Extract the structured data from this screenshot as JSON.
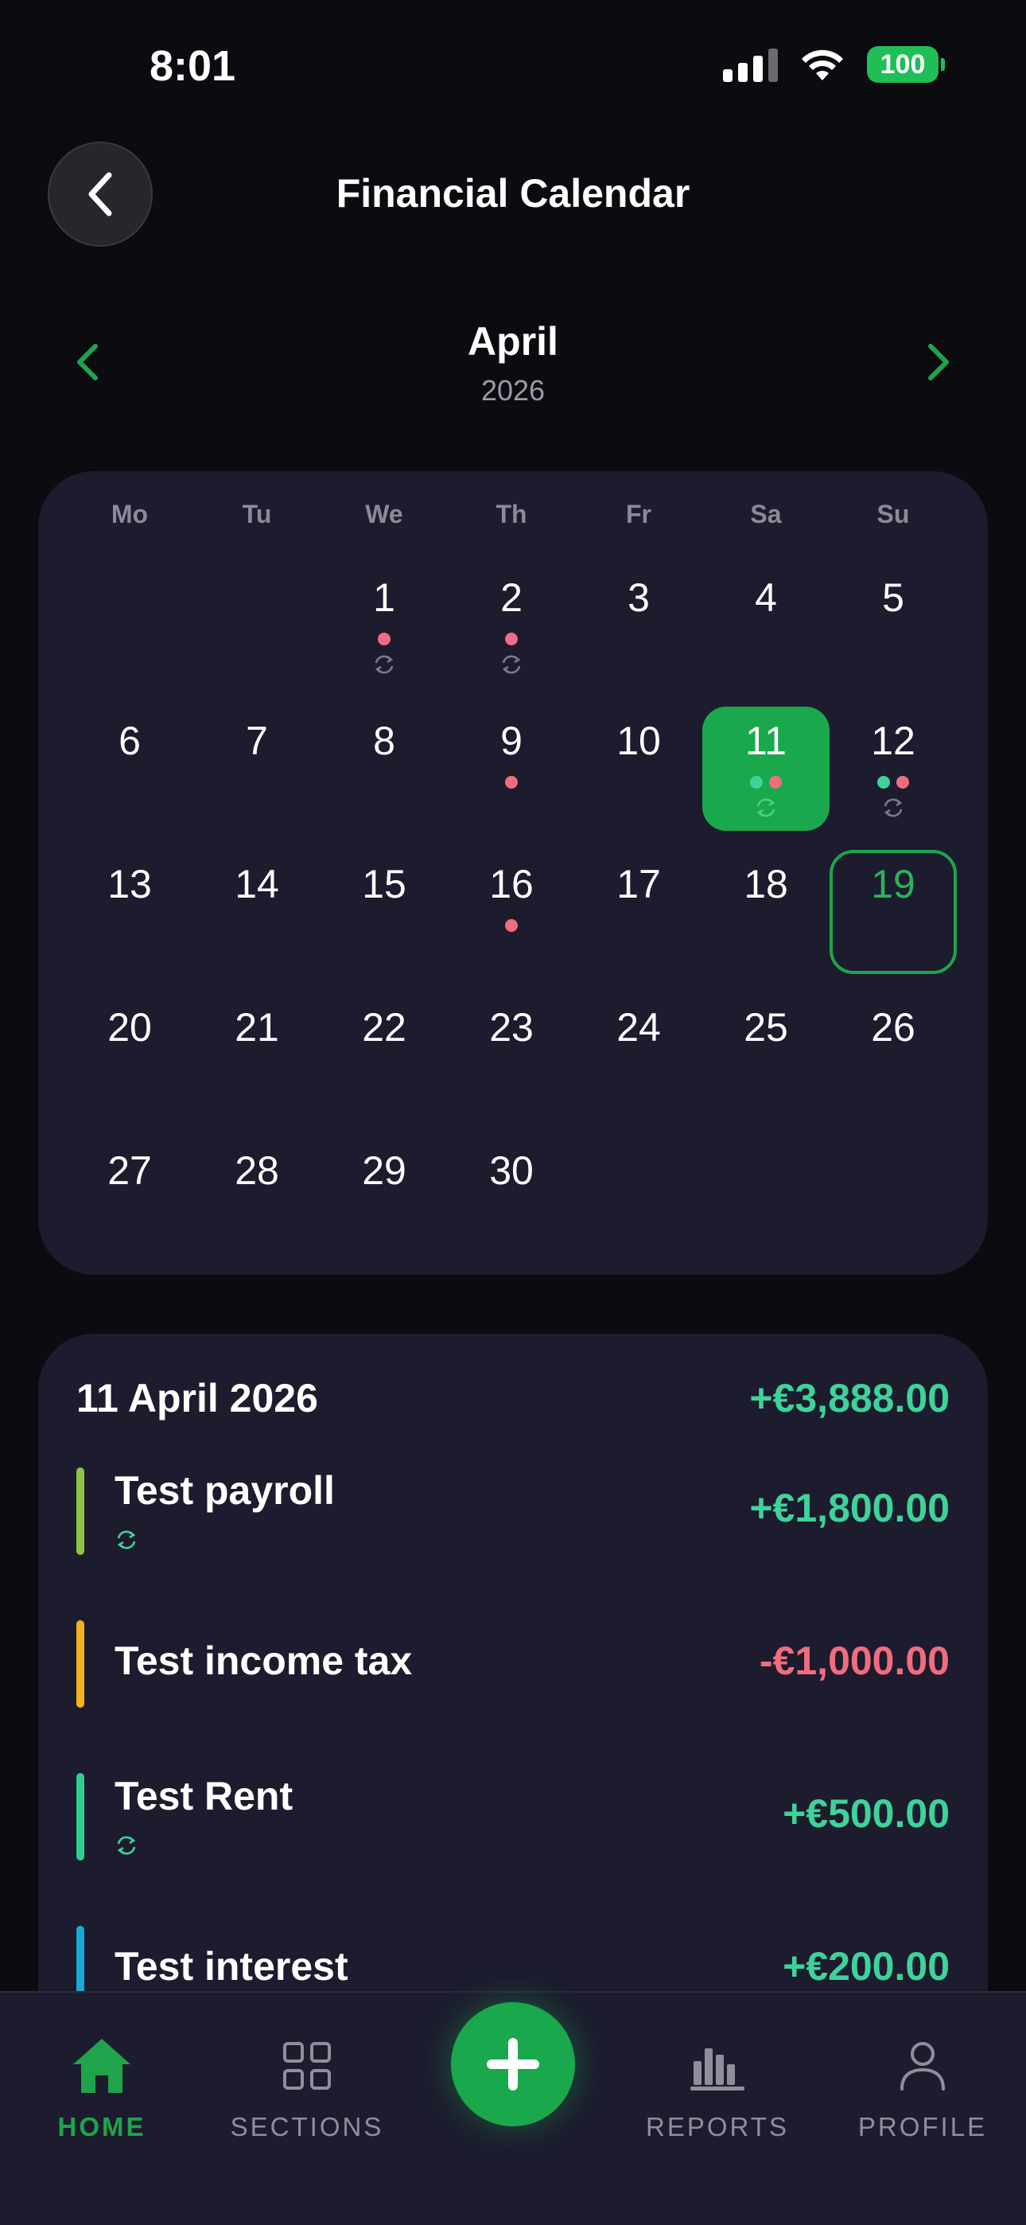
{
  "status_bar": {
    "time": "8:01",
    "battery": "100",
    "icons": [
      "signal-icon",
      "wifi-icon",
      "battery-icon"
    ]
  },
  "header": {
    "title": "Financial Calendar",
    "back_icon": "chevron-left-icon"
  },
  "month_nav": {
    "month": "April",
    "year": "2026",
    "prev_icon": "chevron-left-icon",
    "next_icon": "chevron-right-icon"
  },
  "calendar": {
    "weekdays": [
      "Mo",
      "Tu",
      "We",
      "Th",
      "Fr",
      "Sa",
      "Su"
    ],
    "weeks": [
      [
        "",
        "",
        "1",
        "2",
        "3",
        "4",
        "5"
      ],
      [
        "6",
        "7",
        "8",
        "9",
        "10",
        "11",
        "12"
      ],
      [
        "13",
        "14",
        "15",
        "16",
        "17",
        "18",
        "19"
      ],
      [
        "20",
        "21",
        "22",
        "23",
        "24",
        "25",
        "26"
      ],
      [
        "27",
        "28",
        "29",
        "30",
        "",
        "",
        ""
      ]
    ],
    "selected_day": "11",
    "today": "19",
    "markers": {
      "1": {
        "dots": [
          "expense"
        ],
        "recurring": true
      },
      "2": {
        "dots": [
          "expense"
        ],
        "recurring": true
      },
      "9": {
        "dots": [
          "expense"
        ],
        "recurring": false
      },
      "11": {
        "dots": [
          "income",
          "expense"
        ],
        "recurring": true
      },
      "12": {
        "dots": [
          "income",
          "expense"
        ],
        "recurring": true
      },
      "16": {
        "dots": [
          "expense"
        ],
        "recurring": false
      }
    }
  },
  "day_detail": {
    "date": "11 April 2026",
    "total": "+€3,888.00",
    "transactions": [
      {
        "name": "Test payroll",
        "amount": "+€1,800.00",
        "type": "income",
        "color": "#8cc63f",
        "recurring": true
      },
      {
        "name": "Test income tax",
        "amount": "-€1,000.00",
        "type": "expense",
        "color": "#f2b21a",
        "recurring": false
      },
      {
        "name": "Test Rent",
        "amount": "+€500.00",
        "type": "income",
        "color": "#2ecf8f",
        "recurring": true
      },
      {
        "name": "Test interest",
        "amount": "+€200.00",
        "type": "income",
        "color": "#1aa9d6",
        "recurring": false
      }
    ]
  },
  "bottom_nav": {
    "items": [
      {
        "label": "HOME",
        "icon": "home-icon",
        "active": true
      },
      {
        "label": "SECTIONS",
        "icon": "grid-icon",
        "active": false
      },
      {
        "label": "REPORTS",
        "icon": "bar-chart-icon",
        "active": false
      },
      {
        "label": "PROFILE",
        "icon": "person-icon",
        "active": false
      }
    ],
    "fab_icon": "plus-icon"
  },
  "colors": {
    "accent": "#1aa84c",
    "income": "#3dd39a",
    "expense": "#f06d7f",
    "card": "#1c1c2e",
    "background": "#0b0b10"
  }
}
